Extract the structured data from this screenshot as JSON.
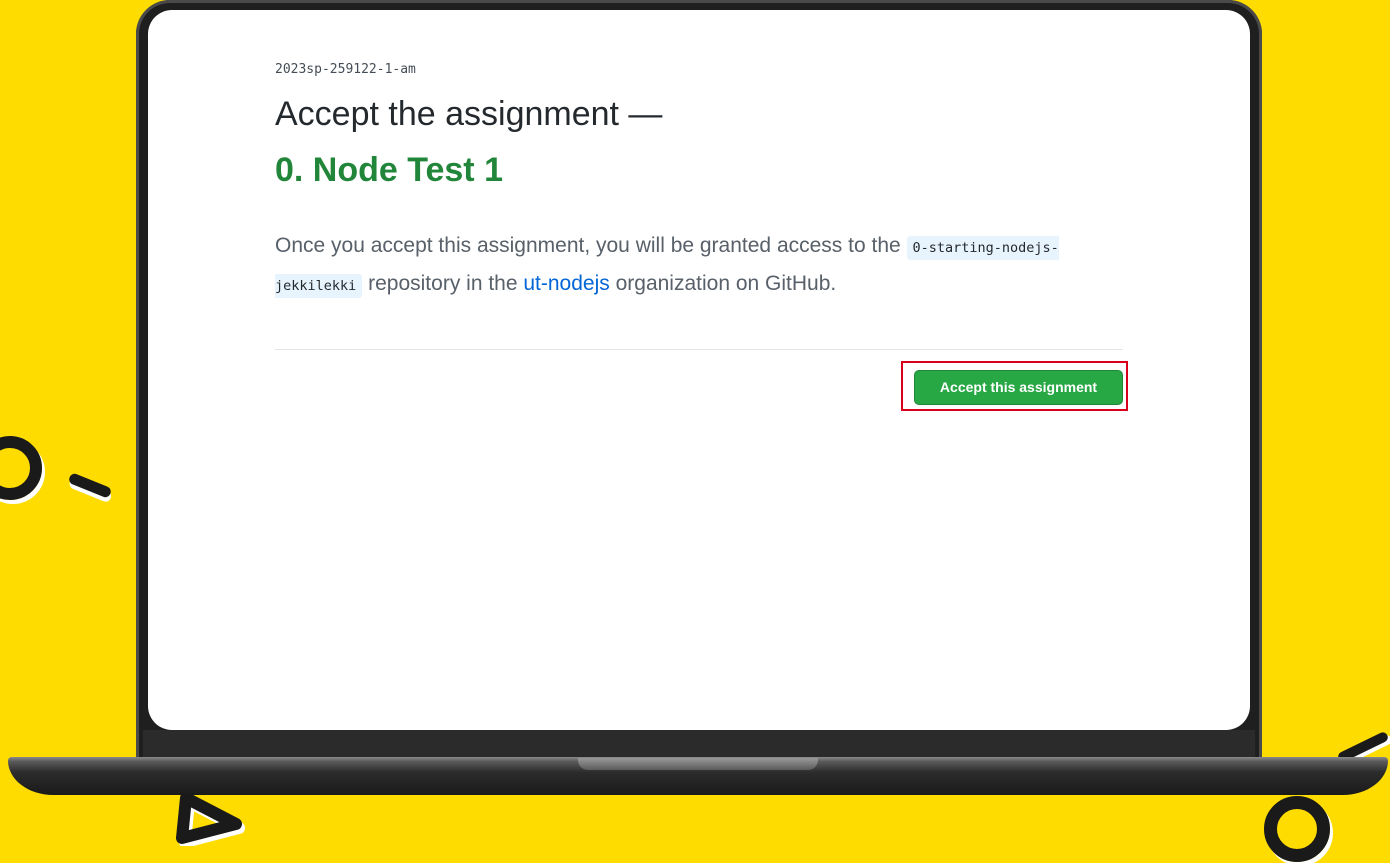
{
  "classroom": {
    "name": "2023sp-259122-1-am"
  },
  "page": {
    "heading": "Accept the assignment —",
    "assignment_title": "0. Node Test 1"
  },
  "description": {
    "part1": "Once you accept this assignment, you will be granted access to the ",
    "repository": "0-starting-nodejs-jekkilekki",
    "part2": " repository in the ",
    "organization": "ut-nodejs",
    "part3": " organization on GitHub."
  },
  "actions": {
    "accept_label": "Accept this assignment"
  },
  "colors": {
    "background": "#FFDC00",
    "title_green": "#22863a",
    "button_green": "#28a745",
    "link_blue": "#0366d6",
    "highlight_red": "#d9001b"
  }
}
